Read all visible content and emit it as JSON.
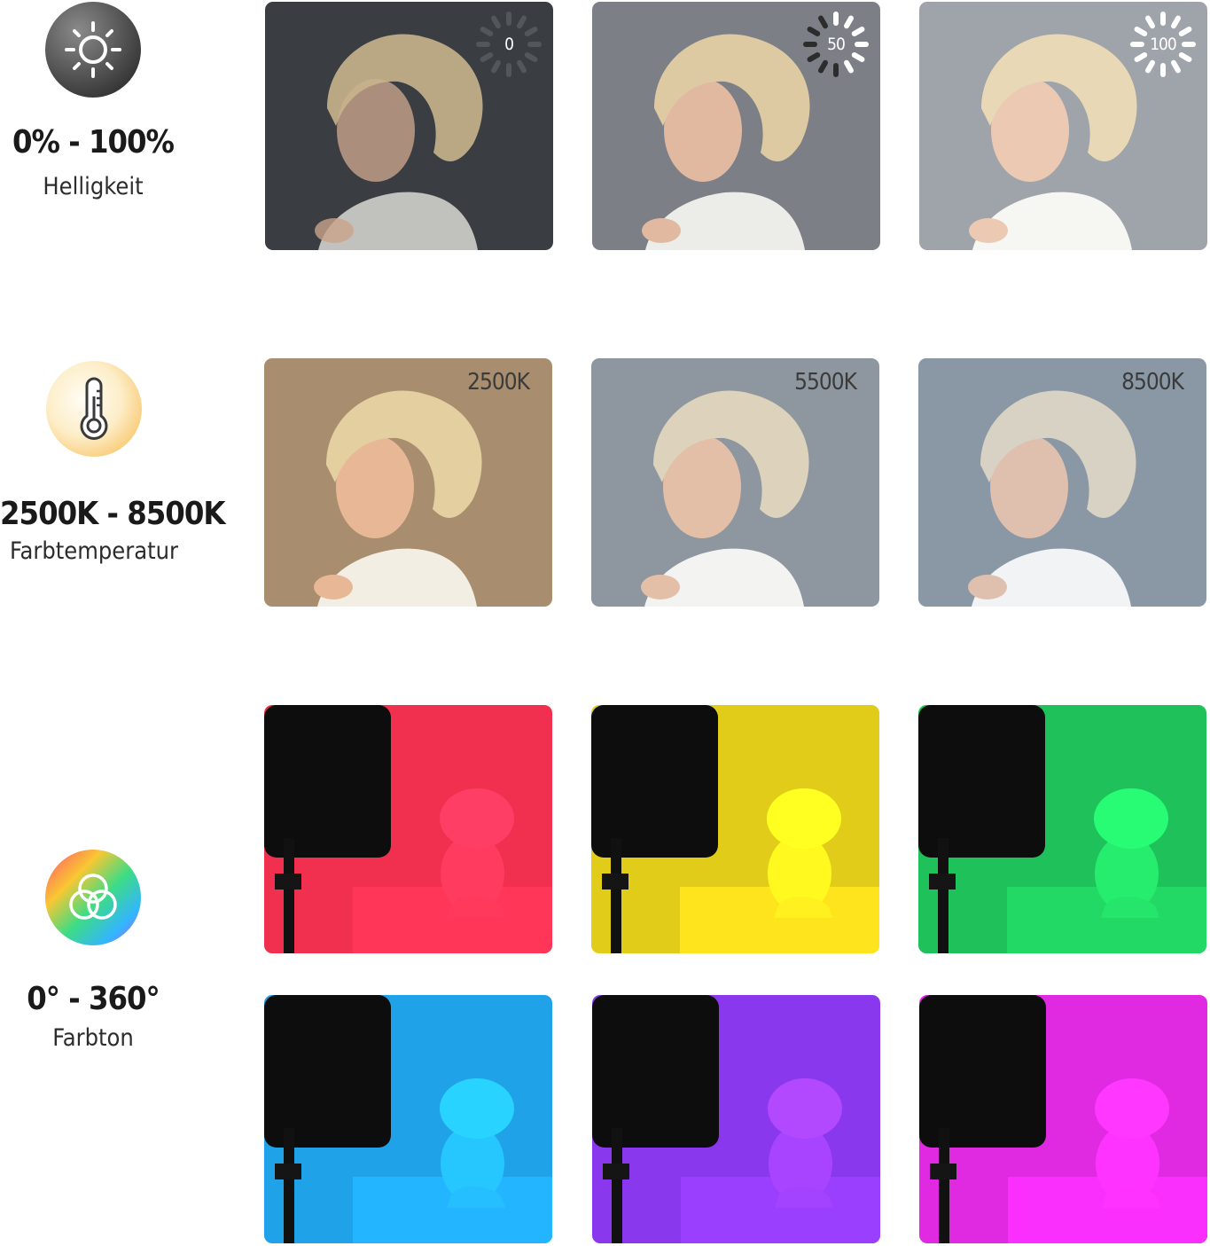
{
  "brightness": {
    "icon": "sun-icon",
    "range": "0% - 100%",
    "caption": "Helligkeit",
    "levels": [
      {
        "label": "0",
        "fraction": 0.0,
        "bg": "#3a3d42"
      },
      {
        "label": "50",
        "fraction": 0.5,
        "bg": "#7c7f86"
      },
      {
        "label": "100",
        "fraction": 1.0,
        "bg": "#9fa3aa"
      }
    ]
  },
  "color_temperature": {
    "icon": "thermometer-icon",
    "range": "2500K - 8500K",
    "caption": "Farbtemperatur",
    "levels": [
      {
        "label": "2500K",
        "bg": "#a88d6f"
      },
      {
        "label": "5500K",
        "bg": "#8e979f"
      },
      {
        "label": "8500K",
        "bg": "#8a98a6"
      }
    ]
  },
  "hue": {
    "icon": "color-circles-icon",
    "range": "0° - 360°",
    "caption": "Farbton",
    "colors": [
      "#f0304e",
      "#e2cc1a",
      "#1fc25a",
      "#1fa2e8",
      "#8a38ee",
      "#df2ae2"
    ]
  }
}
